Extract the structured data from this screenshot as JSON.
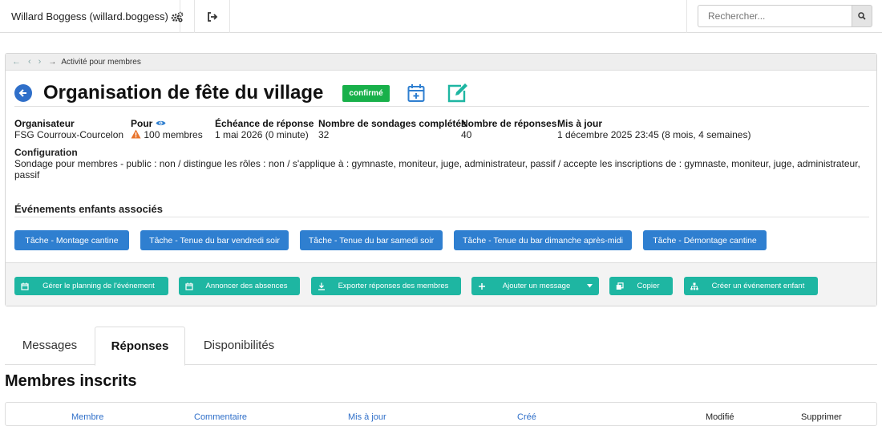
{
  "topbar": {
    "user": "Willard Boggess (willard.boggess)",
    "search_placeholder": "Rechercher..."
  },
  "breadcrumb": {
    "current": "Activité pour membres"
  },
  "header": {
    "title": "Organisation de fête du village",
    "status": "confirmé"
  },
  "meta": [
    {
      "label": "Organisateur",
      "value": "FSG Courroux-Courcelon"
    },
    {
      "label": "Pour",
      "value": "100 membres"
    },
    {
      "label": "Échéance de réponse",
      "value": "1 mai 2026 (0 minute)"
    },
    {
      "label": "Nombre de sondages complétés",
      "value": "32"
    },
    {
      "label": "Nombre de réponses",
      "value": "40"
    },
    {
      "label": "Mis à jour",
      "value": "1 décembre 2025 23:45 (8 mois, 4 semaines)"
    }
  ],
  "config": {
    "label": "Configuration",
    "text": "Sondage pour membres - public : non / distingue les rôles : non / s'applique à : gymnaste, moniteur, juge, administrateur, passif / accepte les inscriptions de : gymnaste, moniteur, juge, administrateur, passif"
  },
  "children": {
    "title": "Événements enfants associés",
    "items": [
      "Tâche - Montage cantine",
      "Tâche - Tenue du bar vendredi soir",
      "Tâche - Tenue du bar samedi soir",
      "Tâche - Tenue du bar dimanche après-midi",
      "Tâche - Démontage cantine"
    ]
  },
  "actions": [
    "Gérer le planning de l'événement",
    "Annoncer des absences",
    "Exporter réponses des membres",
    "Ajouter un message",
    "Copier",
    "Créer un événement enfant"
  ],
  "tabs": [
    "Messages",
    "Réponses",
    "Disponibilités"
  ],
  "section": {
    "title": "Membres inscrits"
  },
  "table": {
    "headers": [
      "Membre",
      "Commentaire",
      "Mis à jour",
      "Créé",
      "Modifié",
      "Supprimer"
    ]
  },
  "colors": {
    "primary": "#2f7fd0",
    "teal": "#1eb6a2",
    "success": "#18b04a",
    "warning": "#e8732b"
  }
}
